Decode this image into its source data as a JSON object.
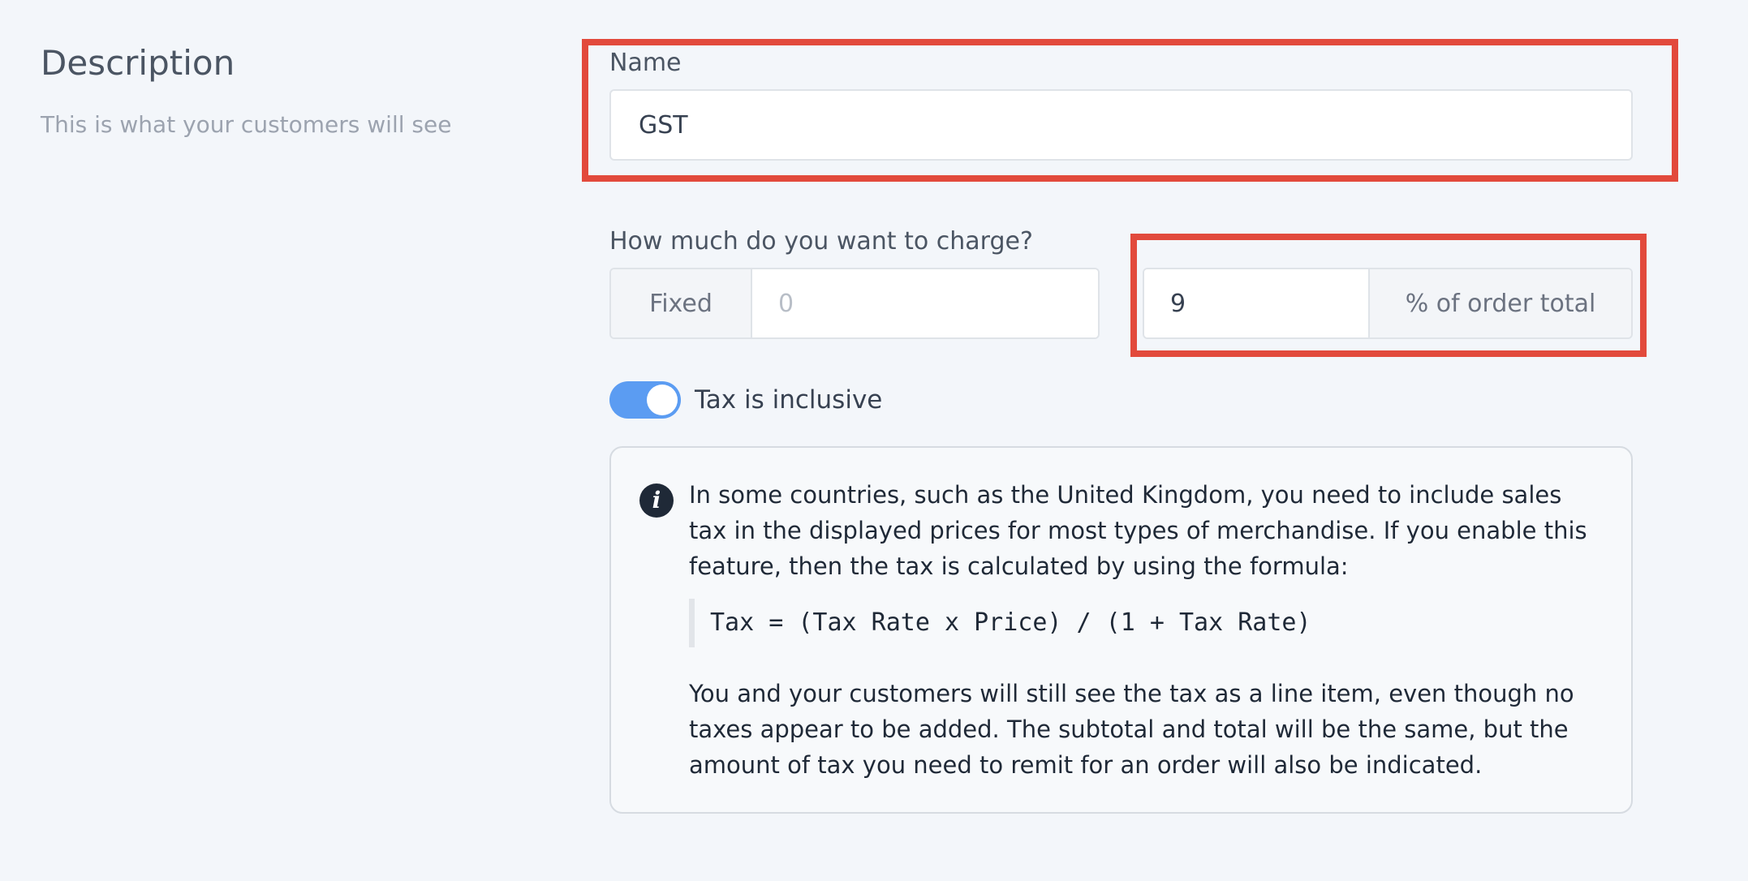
{
  "description": {
    "title": "Description",
    "subtitle": "This is what your customers will see"
  },
  "name_field": {
    "label": "Name",
    "value": "GST"
  },
  "charge": {
    "label": "How much do you want to charge?",
    "fixed_addon": "Fixed",
    "fixed_placeholder": "0",
    "percent_value": "9",
    "percent_addon": "% of order total"
  },
  "tax_inclusive": {
    "label": "Tax is inclusive",
    "enabled": true
  },
  "info": {
    "icon": "info-icon",
    "paragraph1": "In some countries, such as the United Kingdom, you need to include sales tax in the displayed prices for most types of merchandise. If you enable this feature, then the tax is calculated by using the formula:",
    "formula": "Tax = (Tax Rate x Price) / (1 + Tax Rate)",
    "paragraph2": "You and your customers will still see the tax as a line item, even though no taxes appear to be added. The subtotal and total will be the same, but the amount of tax you need to remit for an order will also be indicated."
  },
  "colors": {
    "highlight": "#e24a3c",
    "toggle_on": "#5b9cf2",
    "background": "#f3f6fa"
  }
}
